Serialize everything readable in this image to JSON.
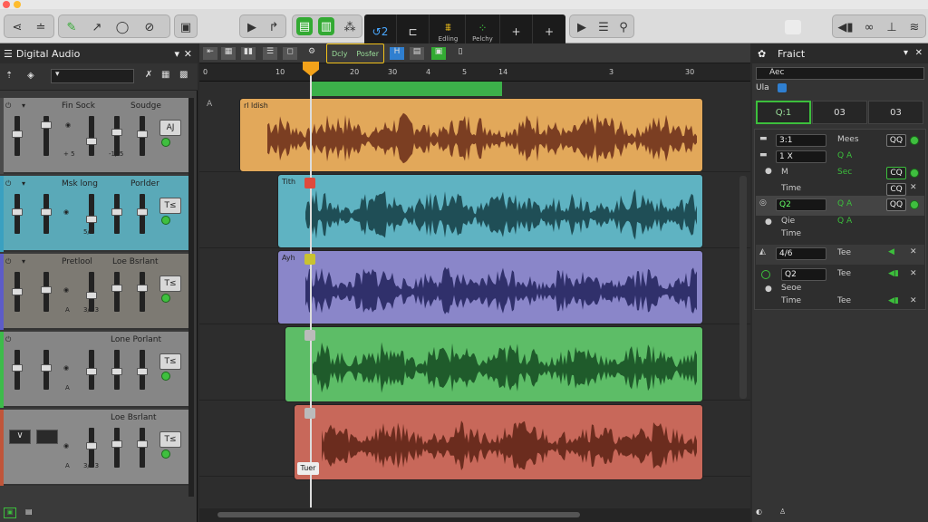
{
  "toolbar": {
    "center_left_label": "Edling",
    "center_right_label": "Pelchy"
  },
  "left_panel": {
    "title": "Digital Audio",
    "tracks": [
      {
        "name_left": "Fin Sock",
        "name_right": "Soudge",
        "button": "AJ",
        "values": [
          "+ 5",
          "-1/-5"
        ],
        "color": "#888888",
        "strip": "#4a4a4a"
      },
      {
        "name_left": "Msk long",
        "name_right": "Porlder",
        "button": "T≤",
        "values": [
          "5/5"
        ],
        "color": "#5aa9b8",
        "strip": "#3aa0c0"
      },
      {
        "name_left": "Pretlool",
        "name_right": "Loe Bsrlant",
        "button": "T≤",
        "values": [
          "A",
          "3/+3"
        ],
        "color": "#7d7a73",
        "strip": "#5d5cc8"
      },
      {
        "name_left": "",
        "name_right": "Lone Porlant",
        "button": "T≤",
        "values": [
          "A"
        ],
        "color": "#878787",
        "strip": "#3dbb4a"
      },
      {
        "name_left": "",
        "name_right": "Loe Bsrlant",
        "button": "T≤",
        "values": [
          "A",
          "3/+3"
        ],
        "color": "#8a8a8a",
        "strip": "#c0553a"
      }
    ]
  },
  "arrange": {
    "ruler_ticks": [
      "0",
      "10",
      "20",
      "30",
      "4",
      "5",
      "14",
      "3",
      "30"
    ],
    "cycle_labels": [
      "Dcly",
      "Posfer"
    ],
    "playhead_label": "Tuer",
    "regions": [
      {
        "name": "rl ldish",
        "color": "#e2a85a",
        "wave": "#7b3e22"
      },
      {
        "name": "Tith",
        "color": "#5fb3c2",
        "wave": "#1f4e56"
      },
      {
        "name": "Ayh",
        "color": "#8a86c9",
        "wave": "#30306b"
      },
      {
        "name": "",
        "color": "#5dbd67",
        "wave": "#1f5b2b"
      },
      {
        "name": "",
        "color": "#c8685a",
        "wave": "#6b2c1e"
      }
    ]
  },
  "inspector": {
    "title": "Fraict",
    "field": "Aec",
    "sub": "Ula",
    "tabs": [
      "Q:1",
      "03",
      "03"
    ],
    "rows": [
      {
        "sel": "3:1",
        "label": "Mees",
        "btn": "QQ"
      },
      {
        "sel": "1 X",
        "label": "Q A",
        "btn": ""
      },
      {
        "sel": "M",
        "label": "Sec",
        "btn": "CQ"
      },
      {
        "sel": "Time",
        "label": "",
        "btn": "CQ"
      },
      {
        "sel": "Q2",
        "label": "Q A",
        "btn": "QQ"
      },
      {
        "sel": "Qie",
        "label": "Q A",
        "btn": ""
      },
      {
        "sel": "Time",
        "label": "",
        "btn": ""
      },
      {
        "sel": "4/6",
        "label": "Tee",
        "btn": ""
      },
      {
        "sel": "Q2",
        "label": "Tee",
        "btn": ""
      },
      {
        "sel": "Seoe",
        "label": "",
        "btn": ""
      },
      {
        "sel": "Time",
        "label": "Tee",
        "btn": ""
      }
    ]
  }
}
